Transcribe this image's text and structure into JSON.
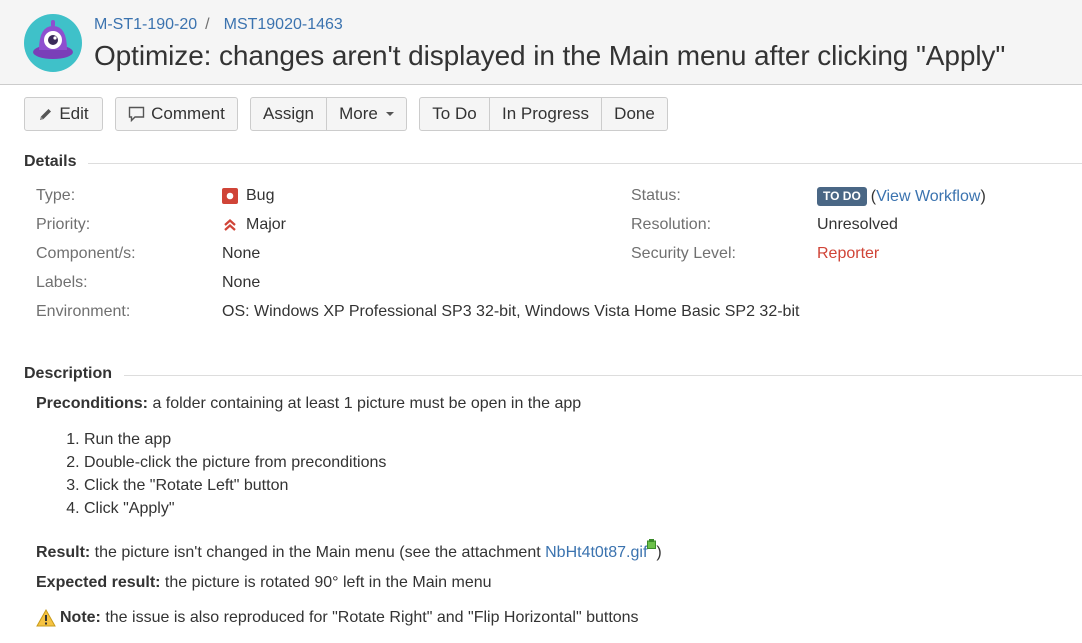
{
  "header": {
    "project_key": "M-ST1-190-20",
    "issue_key": "MST19020-1463",
    "title": "Optimize: changes aren't displayed in the Main menu after clicking \"Apply\""
  },
  "toolbar": {
    "edit": "Edit",
    "comment": "Comment",
    "assign": "Assign",
    "more": "More",
    "todo": "To Do",
    "in_progress": "In Progress",
    "done": "Done"
  },
  "details": {
    "heading": "Details",
    "type_label": "Type:",
    "type_value": "Bug",
    "priority_label": "Priority:",
    "priority_value": "Major",
    "components_label": "Component/s:",
    "components_value": "None",
    "labels_label": "Labels:",
    "labels_value": "None",
    "environment_label": "Environment:",
    "environment_value": "OS: Windows XP Professional SP3 32-bit, Windows Vista Home Basic SP2 32-bit",
    "status_label": "Status:",
    "status_badge": "TO DO",
    "view_workflow": "View Workflow",
    "resolution_label": "Resolution:",
    "resolution_value": "Unresolved",
    "security_label": "Security Level:",
    "security_value": "Reporter"
  },
  "description": {
    "heading": "Description",
    "preconditions_label": "Preconditions:",
    "preconditions_text": " a folder containing at least 1 picture must be open in the app",
    "steps": [
      "Run the app",
      "Double-click the picture from preconditions",
      "Click the \"Rotate Left\" button",
      "Click \"Apply\""
    ],
    "result_label": "Result:",
    "result_text": " the picture isn't changed in the Main menu (see the attachment ",
    "attachment": "NbHt4t0t87.gif",
    "result_close": ")",
    "expected_label": "Expected result:",
    "expected_text": " the picture is rotated 90° left in the Main menu",
    "note_label": "Note:",
    "note_text": " the issue is also reproduced for \"Rotate Right\" and \"Flip Horizontal\" buttons"
  },
  "colors": {
    "link": "#3b73af",
    "status_badge": "#4a6785",
    "reporter": "#d04437",
    "bug": "#d04437",
    "priority": "#d04437"
  },
  "icons": [
    "project-avatar-icon",
    "pencil-icon",
    "comment-icon",
    "bug-icon",
    "priority-major-icon",
    "attachment-icon",
    "warning-icon"
  ]
}
